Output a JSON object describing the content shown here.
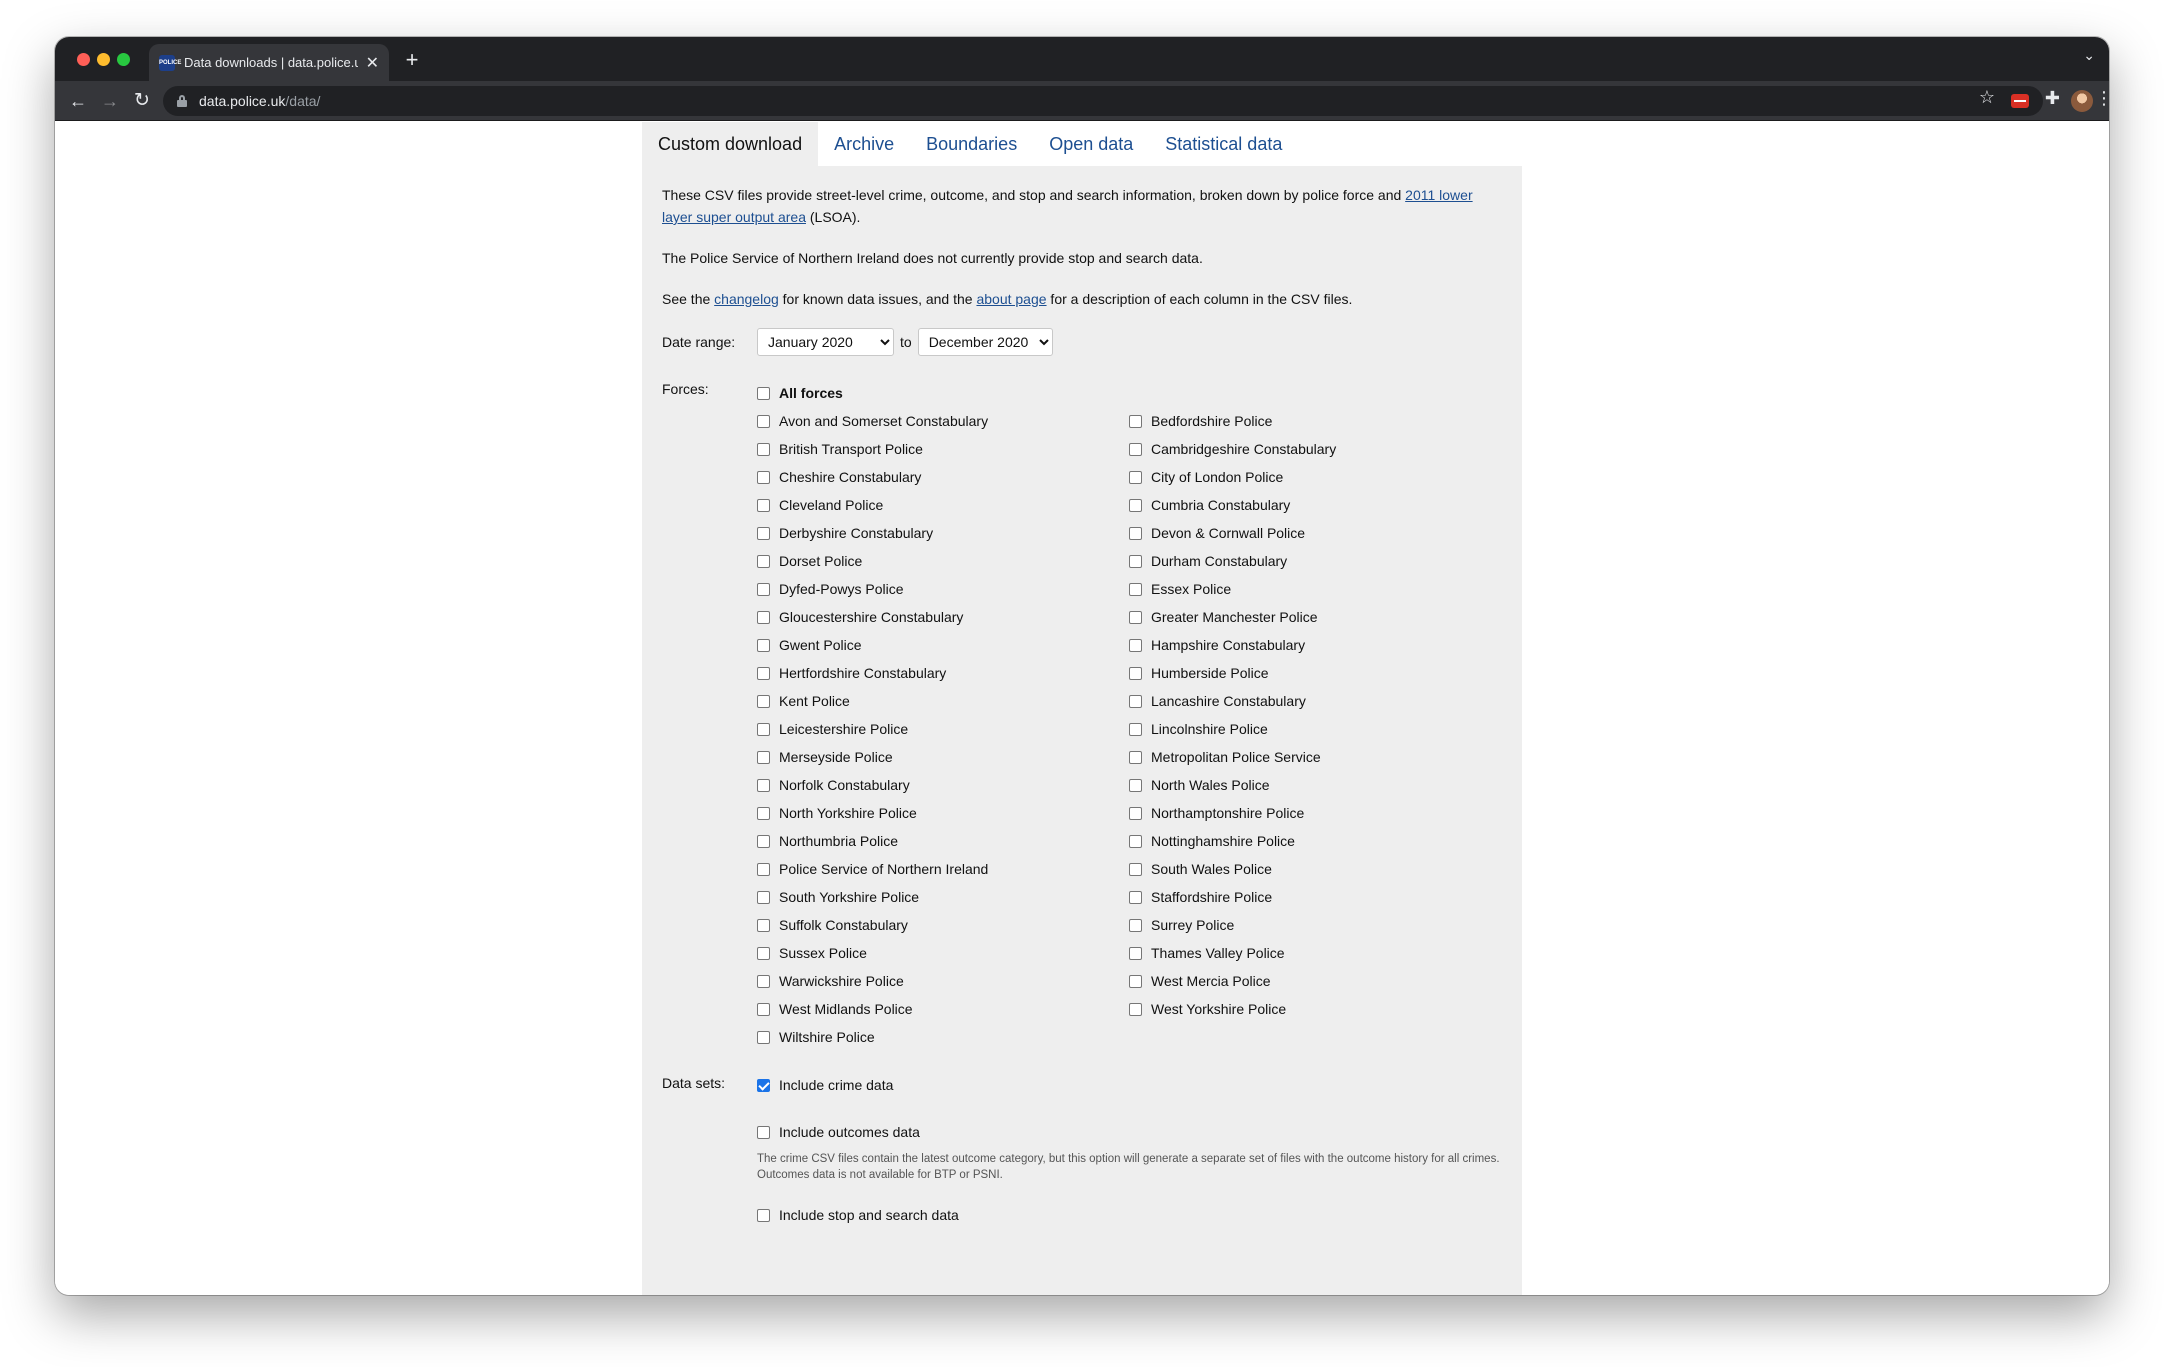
{
  "browser": {
    "tab_title": "Data downloads | data.police.uk",
    "favicon_text": "POLICE",
    "url_host": "data.police.uk",
    "url_path": "/data/"
  },
  "nav_tabs": [
    {
      "label": "Custom download",
      "active": true
    },
    {
      "label": "Archive",
      "active": false
    },
    {
      "label": "Boundaries",
      "active": false
    },
    {
      "label": "Open data",
      "active": false
    },
    {
      "label": "Statistical data",
      "active": false
    }
  ],
  "intro": {
    "p1_before": "These CSV files provide street-level crime, outcome, and stop and search information, broken down by police force and ",
    "p1_link": "2011 lower layer super output area",
    "p1_after": " (LSOA).",
    "p2": "The Police Service of Northern Ireland does not currently provide stop and search data.",
    "p3_a": "See the ",
    "p3_link1": "changelog",
    "p3_b": " for known data issues, and the ",
    "p3_link2": "about page",
    "p3_c": " for a description of each column in the CSV files."
  },
  "date_range": {
    "label": "Date range:",
    "from": "January 2020",
    "to_word": "to",
    "to": "December 2020"
  },
  "forces": {
    "label": "Forces:",
    "all_label": "All forces",
    "left": [
      "Avon and Somerset Constabulary",
      "British Transport Police",
      "Cheshire Constabulary",
      "Cleveland Police",
      "Derbyshire Constabulary",
      "Dorset Police",
      "Dyfed-Powys Police",
      "Gloucestershire Constabulary",
      "Gwent Police",
      "Hertfordshire Constabulary",
      "Kent Police",
      "Leicestershire Police",
      "Merseyside Police",
      "Norfolk Constabulary",
      "North Yorkshire Police",
      "Northumbria Police",
      "Police Service of Northern Ireland",
      "South Yorkshire Police",
      "Suffolk Constabulary",
      "Sussex Police",
      "Warwickshire Police",
      "West Midlands Police",
      "Wiltshire Police"
    ],
    "right": [
      "Bedfordshire Police",
      "Cambridgeshire Constabulary",
      "City of London Police",
      "Cumbria Constabulary",
      "Devon & Cornwall Police",
      "Durham Constabulary",
      "Essex Police",
      "Greater Manchester Police",
      "Hampshire Constabulary",
      "Humberside Police",
      "Lancashire Constabulary",
      "Lincolnshire Police",
      "Metropolitan Police Service",
      "North Wales Police",
      "Northamptonshire Police",
      "Nottinghamshire Police",
      "South Wales Police",
      "Staffordshire Police",
      "Surrey Police",
      "Thames Valley Police",
      "West Mercia Police",
      "West Yorkshire Police"
    ]
  },
  "datasets": {
    "label": "Data sets:",
    "crime": "Include crime data",
    "crime_checked": true,
    "outcomes": "Include outcomes data",
    "outcomes_note": "The crime CSV files contain the latest outcome category, but this option will generate a separate set of files with the outcome history for all crimes. Outcomes data is not available for BTP or PSNI.",
    "stop_search": "Include stop and search data"
  },
  "colors": {
    "link": "#1d4f91",
    "panel": "#eeeeee",
    "generate_button": "#d9644f"
  }
}
